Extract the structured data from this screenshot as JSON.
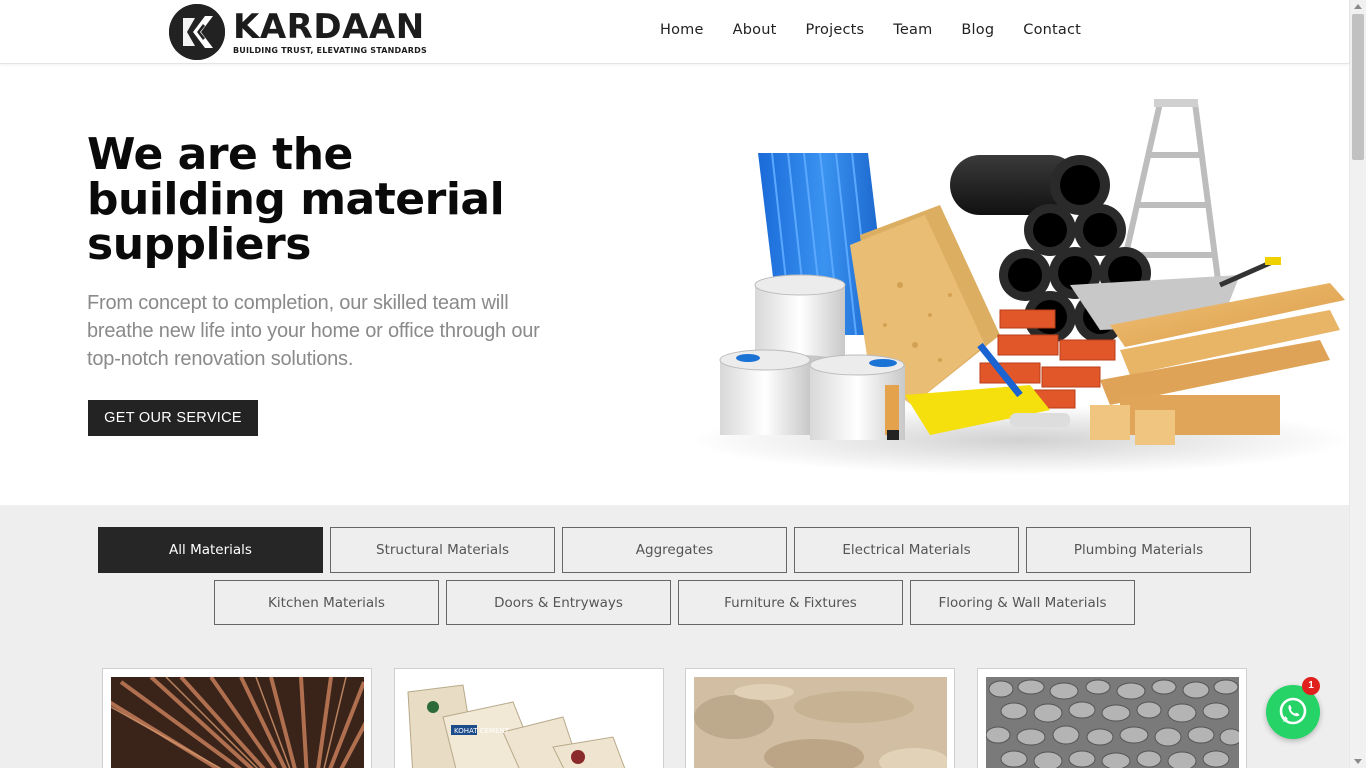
{
  "brand": {
    "name": "KARDAAN",
    "tagline": "BUILDING TRUST, ELEVATING STANDARDS"
  },
  "nav": {
    "items": [
      {
        "label": "Home"
      },
      {
        "label": "About"
      },
      {
        "label": "Projects"
      },
      {
        "label": "Team"
      },
      {
        "label": "Blog"
      },
      {
        "label": "Contact"
      }
    ]
  },
  "hero": {
    "title_line1": "We are the",
    "title_line2": "building material",
    "title_line3": "suppliers",
    "subtitle": "From concept to completion, our skilled team will breathe new life into your home or office through our top-notch renovation solutions.",
    "cta_label": "GET OUR SERVICE"
  },
  "filters": {
    "row1": [
      {
        "label": "All Materials",
        "active": true
      },
      {
        "label": "Structural Materials"
      },
      {
        "label": "Aggregates"
      },
      {
        "label": "Electrical Materials"
      },
      {
        "label": "Plumbing Materials"
      }
    ],
    "row2": [
      {
        "label": "Kitchen Materials"
      },
      {
        "label": "Doors & Entryways"
      },
      {
        "label": "Furniture & Fixtures"
      },
      {
        "label": "Flooring & Wall Materials"
      }
    ]
  },
  "products": [
    {
      "icon": "steel-rebar-image"
    },
    {
      "icon": "cement-bags-image",
      "brand_text": "KOHAT CEMENT"
    },
    {
      "icon": "sand-image"
    },
    {
      "icon": "gravel-image"
    }
  ],
  "whatsapp": {
    "badge_count": "1"
  },
  "colors": {
    "dark": "#232323",
    "section_bg": "#eeeeee",
    "whatsapp_green": "#25d366",
    "badge_red": "#e0201c"
  }
}
